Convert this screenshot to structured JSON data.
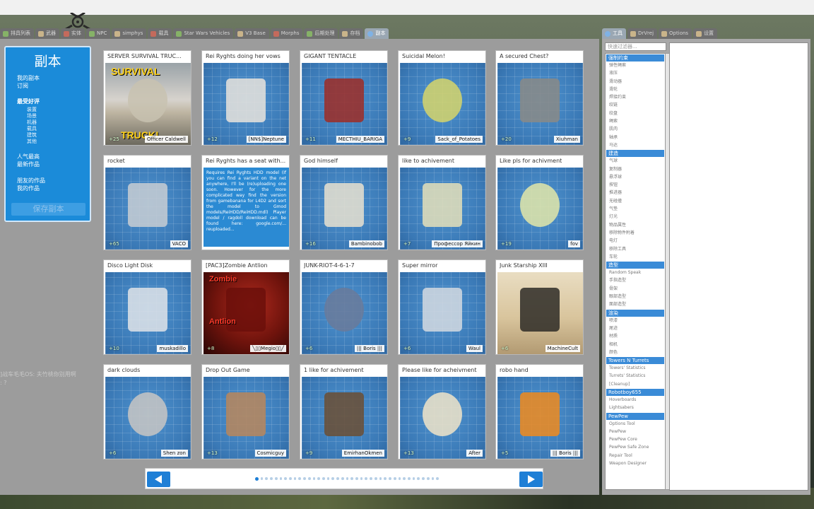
{
  "top_tabs": [
    {
      "label": "排具列表",
      "icon": "list-icon"
    },
    {
      "label": "武器",
      "icon": "gun-icon"
    },
    {
      "label": "实体",
      "icon": "cube-icon"
    },
    {
      "label": "NPC",
      "icon": "npc-icon"
    },
    {
      "label": "simphys",
      "icon": "car-icon"
    },
    {
      "label": "载具",
      "icon": "car-icon"
    },
    {
      "label": "Star Wars Vehicles",
      "icon": "ship-icon"
    },
    {
      "label": "V3 Base",
      "icon": "base-icon"
    },
    {
      "label": "Morphs",
      "icon": "morph-icon"
    },
    {
      "label": "后期处理",
      "icon": "fx-icon"
    },
    {
      "label": "存档",
      "icon": "save-icon"
    },
    {
      "label": "副本",
      "icon": "dupe-icon"
    }
  ],
  "side_menu": {
    "title": "副本",
    "my_dupes": "我的副本",
    "subscribed": "订阅",
    "latest": "最受好评",
    "categories": [
      "装置",
      "场景",
      "机器",
      "载具",
      "建筑",
      "其他"
    ],
    "popular": "人气最高",
    "newest": "最新作品",
    "friends": "朋友的作品",
    "mine": "我的作品",
    "save_button": "保存副本"
  },
  "cards": [
    {
      "title": "SERVER SURVIVAL TRUC...",
      "likes": "+25",
      "author": "Officer Caldwell",
      "overlay_top": "SURVIVAL",
      "overlay_bottom": "TRUCK!"
    },
    {
      "title": "Rei Ryghts doing her vows",
      "likes": "+12",
      "author": "[NN$]Neptune"
    },
    {
      "title": "GIGANT TENTACLE",
      "likes": "+11",
      "author": "MECTHIU_BARIGA"
    },
    {
      "title": "Suicidal Melon!",
      "likes": "+9",
      "author": "Sack_of_Potatoes"
    },
    {
      "title": "A secured Chest?",
      "likes": "+20",
      "author": "Xiuhman"
    },
    {
      "title": "rocket",
      "likes": "+65",
      "author": "VACO"
    },
    {
      "title": "Rei Ryghts has a seat with...",
      "likes": "",
      "author": "",
      "description": "Requires Rei Ryghts HDD model (If you can find a variant on the net anywhere, I'll be (re)uploading one soon. However for the more complicated way find the version from gamebanana for L4D2 and sort the model to Gmod models/ReiHDD/ReiHDD.mdl) Player model / ragdoll download can be found here: google.com/... reuploaded...",
      "comment_button": "评论/投票",
      "copy_button": "复制它"
    },
    {
      "title": "God himself",
      "likes": "+16",
      "author": "Bambinobob"
    },
    {
      "title": "like to achivement",
      "likes": "+7",
      "author": "Профессор Яйкин"
    },
    {
      "title": "Like pls for achivment",
      "likes": "+19",
      "author": "fov"
    },
    {
      "title": "Disco Light Disk",
      "likes": "+10",
      "author": "muskadillo"
    },
    {
      "title": "[PAC3]Zombie Antlion",
      "likes": "+8",
      "author": "╲▯▯Megio▯▯╱",
      "overlay_top": "Zombie",
      "overlay_bottom": "Antlion"
    },
    {
      "title": "JUNK-RIOT-4-6-1-7",
      "likes": "+6",
      "author": "||| Boris |||"
    },
    {
      "title": "Super mirror",
      "likes": "+6",
      "author": "Waul"
    },
    {
      "title": "Junk Starship XIII",
      "likes": "+6",
      "author": "MachineCult"
    },
    {
      "title": "dark clouds",
      "likes": "+6",
      "author": "Shen zon"
    },
    {
      "title": "Drop Out Game",
      "likes": "+13",
      "author": "Cosmicguy"
    },
    {
      "title": "1 like for achivement",
      "likes": "+9",
      "author": "EmirhanOkmen"
    },
    {
      "title": "Please like for acheivment",
      "likes": "+13",
      "author": "After"
    },
    {
      "title": "robo hand",
      "likes": "+5",
      "author": "||| Boris |||"
    }
  ],
  "pager": {
    "current_page": 1,
    "total_dots": 39
  },
  "right_tabs": [
    {
      "label": "工具",
      "icon": "wrench-icon"
    },
    {
      "label": "DrVrej",
      "icon": "gear-icon"
    },
    {
      "label": "Options",
      "icon": "gear-icon"
    },
    {
      "label": "设置",
      "icon": "gear-icon"
    }
  ],
  "tool_search": {
    "placeholder": "快速过滤器..."
  },
  "tool_list": [
    {
      "type": "header",
      "label": "强制约束"
    },
    {
      "type": "item",
      "label": "弹性绳索"
    },
    {
      "type": "item",
      "label": "液压"
    },
    {
      "type": "item",
      "label": "滑动器"
    },
    {
      "type": "item",
      "label": "滑轮"
    },
    {
      "type": "item",
      "label": "焊接约束"
    },
    {
      "type": "item",
      "label": "绞链"
    },
    {
      "type": "item",
      "label": "绞盘"
    },
    {
      "type": "item",
      "label": "绳索"
    },
    {
      "type": "item",
      "label": "肌肉"
    },
    {
      "type": "item",
      "label": "轴承"
    },
    {
      "type": "item",
      "label": "马达"
    },
    {
      "type": "header",
      "label": "建造"
    },
    {
      "type": "item",
      "label": "气球"
    },
    {
      "type": "item",
      "label": "复制器"
    },
    {
      "type": "item",
      "label": "悬浮球"
    },
    {
      "type": "item",
      "label": "按钮"
    },
    {
      "type": "item",
      "label": "推进器"
    },
    {
      "type": "item",
      "label": "无碰撞"
    },
    {
      "type": "item",
      "label": "气垫"
    },
    {
      "type": "item",
      "label": "灯光"
    },
    {
      "type": "item",
      "label": "物品属性"
    },
    {
      "type": "item",
      "label": "移除物件附着"
    },
    {
      "type": "item",
      "label": "电灯"
    },
    {
      "type": "item",
      "label": "移除工具"
    },
    {
      "type": "item",
      "label": "车轮"
    },
    {
      "type": "header",
      "label": "造型"
    },
    {
      "type": "item",
      "label": "Random Speak"
    },
    {
      "type": "item",
      "label": "手指造型"
    },
    {
      "type": "item",
      "label": "骨架"
    },
    {
      "type": "item",
      "label": "眼部造型"
    },
    {
      "type": "item",
      "label": "面部造型"
    },
    {
      "type": "header",
      "label": "渲染"
    },
    {
      "type": "item",
      "label": "喷漆"
    },
    {
      "type": "item",
      "label": "尾迹"
    },
    {
      "type": "item",
      "label": "材质"
    },
    {
      "type": "item",
      "label": "相机"
    },
    {
      "type": "item",
      "label": "颜色"
    },
    {
      "type": "header",
      "label": "Towers N Turrets"
    },
    {
      "type": "item",
      "label": "Towers' Statistics"
    },
    {
      "type": "item",
      "label": "Turrets' Statistics"
    },
    {
      "type": "item",
      "label": "[Cleanup]"
    },
    {
      "type": "header",
      "label": "Robotboy655"
    },
    {
      "type": "item",
      "label": "Hoverboards"
    },
    {
      "type": "item",
      "label": "Lightsabers"
    },
    {
      "type": "header",
      "label": "PewPew"
    },
    {
      "type": "item",
      "label": "Options Tool"
    },
    {
      "type": "item",
      "label": "PewPew"
    },
    {
      "type": "item",
      "label": "PewPew Core"
    },
    {
      "type": "item",
      "label": "PewPew Safe Zone"
    },
    {
      "type": "item",
      "label": "Repair Tool"
    },
    {
      "type": "item",
      "label": "Weapon Designer"
    }
  ],
  "chat": {
    "line1": "]战车毛毛OS: 夫竹桃你别用啊",
    "line2": ": ?"
  },
  "colors": {
    "accent_blue": "#1b8bd9",
    "panel_grey": "#9c9c9c",
    "card_bg": "#3a79b6"
  }
}
